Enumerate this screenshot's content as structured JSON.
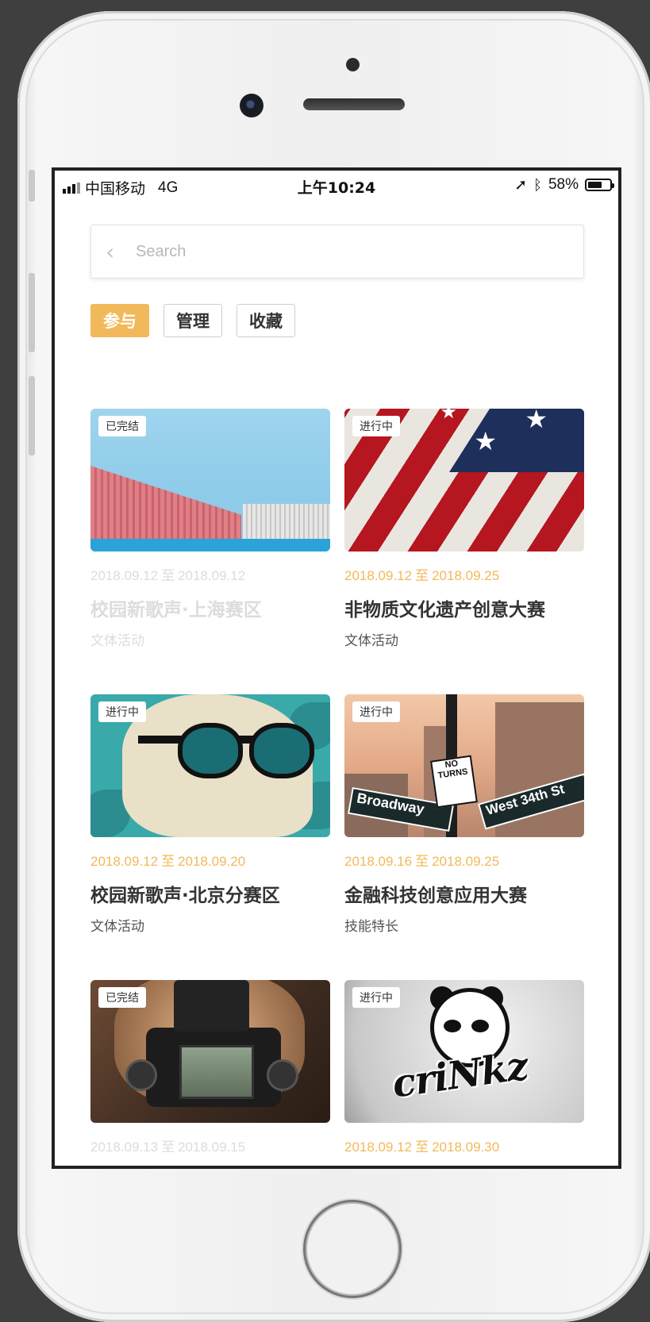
{
  "status_bar": {
    "carrier": "中国移动",
    "network": "4G",
    "time": "上午10:24",
    "battery": "58%"
  },
  "search": {
    "placeholder": "Search"
  },
  "tabs": [
    {
      "label": "参与",
      "active": true
    },
    {
      "label": "管理",
      "active": false
    },
    {
      "label": "收藏",
      "active": false
    }
  ],
  "cards": [
    {
      "status": "已完结",
      "start": "2018.09.12",
      "sep": "至",
      "end": "2018.09.12",
      "title": "校园新歌声·上海赛区",
      "category": "文体活动",
      "image": "shipping-container-photo"
    },
    {
      "status": "进行中",
      "start": "2018.09.12",
      "sep": "至",
      "end": "2018.09.25",
      "title": "非物质文化遗产创意大赛",
      "category": "文体活动",
      "image": "american-flag-photo"
    },
    {
      "status": "进行中",
      "start": "2018.09.12",
      "sep": "至",
      "end": "2018.09.20",
      "title": "校园新歌声·北京分赛区",
      "category": "文体活动",
      "image": "sunglasses-portrait-illustration"
    },
    {
      "status": "进行中",
      "start": "2018.09.16",
      "sep": "至",
      "end": "2018.09.25",
      "title": "金融科技创意应用大赛",
      "category": "技能特长",
      "image": "new-york-street-signs-photo"
    },
    {
      "status": "已完结",
      "start": "2018.09.13",
      "sep": "至",
      "end": "2018.09.15",
      "title": "",
      "category": "",
      "image": "vintage-camera-photo"
    },
    {
      "status": "进行中",
      "start": "2018.09.12",
      "sep": "至",
      "end": "2018.09.30",
      "title": "",
      "category": "",
      "image": "panda-crinkz-logo"
    }
  ],
  "image_text": {
    "street_sign_broadway": "Broadway",
    "street_sign_34th": "West 34th St",
    "street_sign_no_turns": "NO TURNS",
    "panda_logo": "criNkz"
  },
  "colors": {
    "accent": "#f2b95a",
    "active_tab_text": "#ffffff",
    "done_text": "#dcdcdc"
  }
}
